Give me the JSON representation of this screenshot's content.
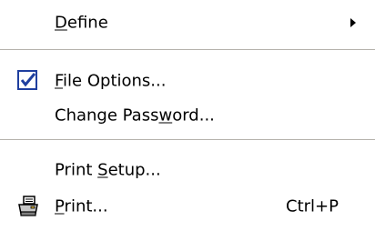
{
  "menu": {
    "items": [
      {
        "label_pre": "",
        "label_u": "D",
        "label_post": "efine",
        "has_submenu": true
      },
      {
        "label_pre": "",
        "label_u": "F",
        "label_post": "ile Options...",
        "checked": true,
        "icon": "checkmark-icon"
      },
      {
        "label_pre": "Change Pass",
        "label_u": "w",
        "label_post": "ord..."
      },
      {
        "label_pre": "Print ",
        "label_u": "S",
        "label_post": "etup..."
      },
      {
        "label_pre": "",
        "label_u": "P",
        "label_post": "rint...",
        "icon": "printer-icon",
        "shortcut": "Ctrl+P"
      }
    ]
  },
  "colors": {
    "background": "#ffffff",
    "separator": "#b5b2ac",
    "check": "#1f3f9f"
  }
}
